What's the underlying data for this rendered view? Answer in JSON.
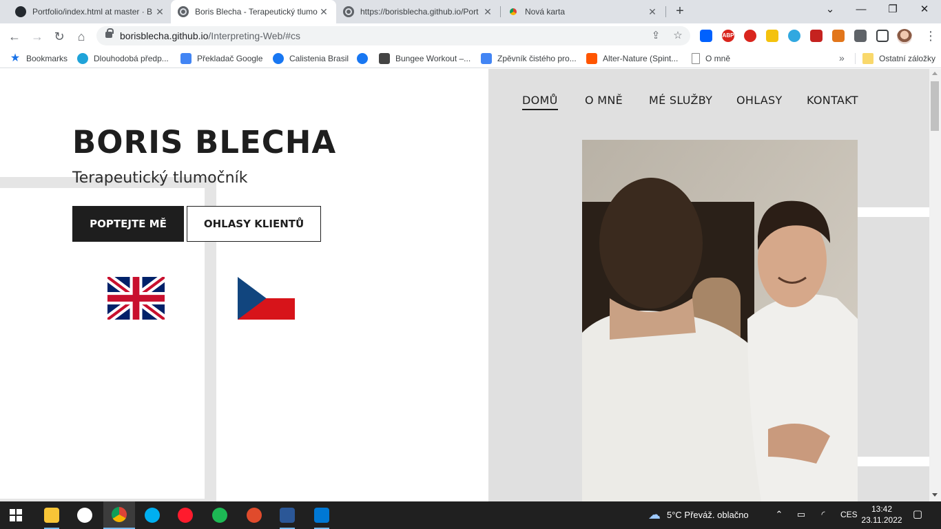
{
  "browser": {
    "tabs": [
      {
        "title": "Portfolio/index.html at master · B",
        "icon": "github-icon",
        "active": false
      },
      {
        "title": "Boris Blecha - Terapeutický tlumo",
        "icon": "globe-icon",
        "active": true
      },
      {
        "title": "https://borisblecha.github.io/Port",
        "icon": "globe-icon",
        "active": false
      },
      {
        "title": "Nová karta",
        "icon": "chrome-icon",
        "active": false
      }
    ],
    "url_host": "borisblecha.github.io",
    "url_path": "/Interpreting-Web/#cs",
    "bookmarks": [
      {
        "label": "Bookmarks",
        "icon": "star-icon"
      },
      {
        "label": "Dlouhodobá předp...",
        "icon": "yr-weather-icon"
      },
      {
        "label": "Překladač Google",
        "icon": "google-translate-icon"
      },
      {
        "label": "Calistenia Brasil",
        "icon": "facebook-icon"
      },
      {
        "label": "",
        "icon": "facebook-icon"
      },
      {
        "label": "Bungee Workout –...",
        "icon": "dd-icon"
      },
      {
        "label": "Zpěvník čistého pro...",
        "icon": "google-docs-icon"
      },
      {
        "label": "Alter-Nature (Spint...",
        "icon": "soundcloud-icon"
      },
      {
        "label": "O mně",
        "icon": "file-icon"
      },
      {
        "label": "Ostatní záložky",
        "icon": "folder-icon"
      }
    ],
    "bookmarks_more": "»"
  },
  "page": {
    "title": "BORIS BLECHA",
    "subtitle": "Terapeutický tlumočník",
    "primary_button": "POPTEJTE MĚ",
    "secondary_button": "OHLASY KLIENTŮ",
    "nav": [
      "DOMŮ",
      "O MNĚ",
      "MÉ SLUŽBY",
      "OHLASY",
      "KONTAKT"
    ],
    "nav_active": "DOMŮ",
    "languages": [
      "english-flag",
      "czech-flag"
    ],
    "colors": {
      "accent": "#1e1e1e",
      "panel": "#e0e0e0"
    }
  },
  "taskbar": {
    "weather": "5°C  Převáž. oblačno",
    "lang": "CES",
    "time": "13:42",
    "date": "23.11.2022"
  }
}
